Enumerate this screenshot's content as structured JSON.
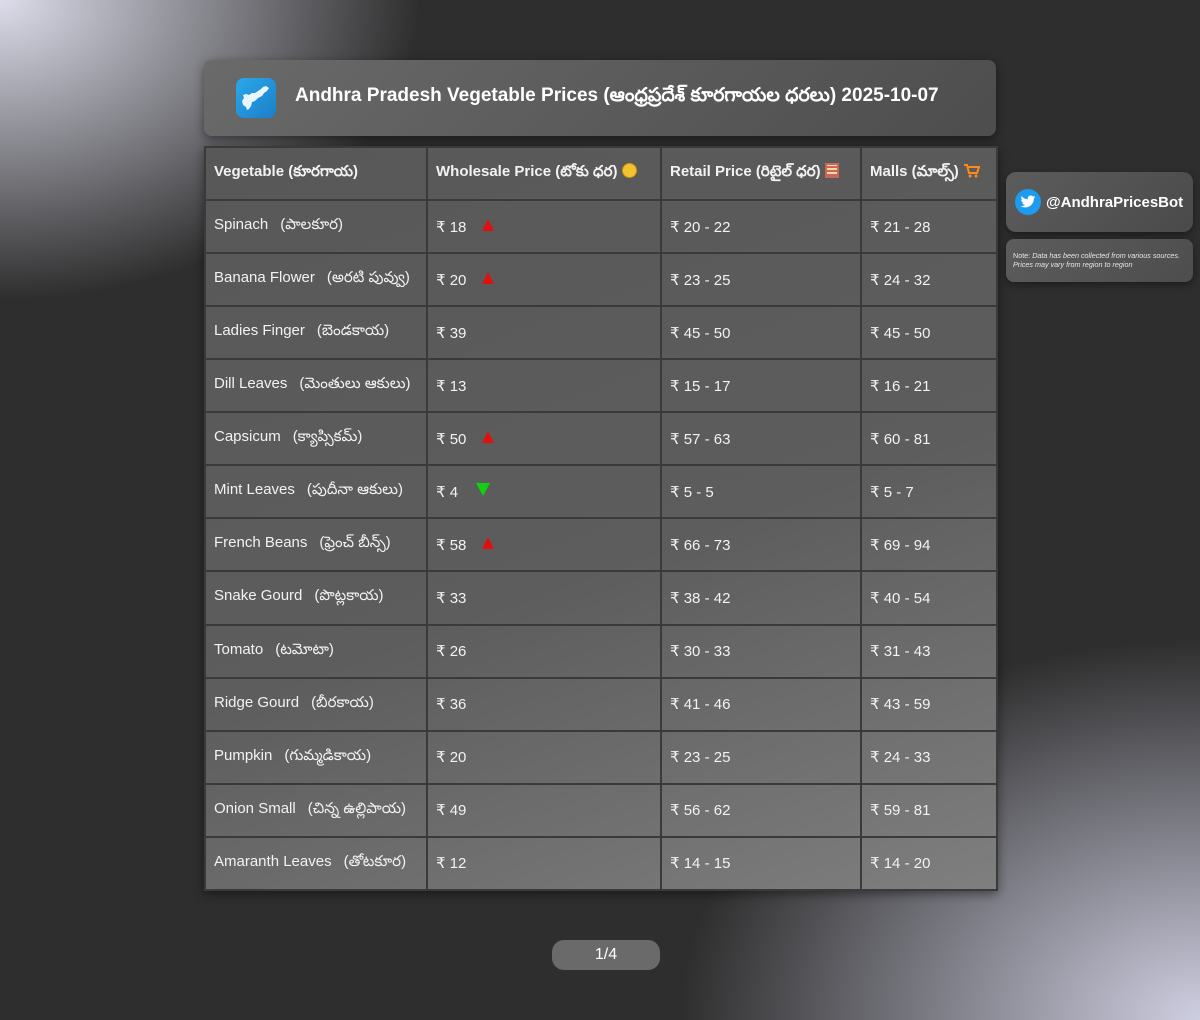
{
  "header": {
    "logo_icon": "andhra-map-icon",
    "title": "Andhra Pradesh Vegetable Prices (ఆంధ్రప్రదేశ్ కూరగాయల ధరలు) 2025-10-07"
  },
  "table": {
    "columns": [
      {
        "label": "Vegetable (కూరగాయ)",
        "icon": ""
      },
      {
        "label": "Wholesale Price (టోకు ధర)",
        "icon": "coin-icon"
      },
      {
        "label": "Retail Price (రిటైల్ ధర)",
        "icon": "building-icon"
      },
      {
        "label": "Malls (మాల్స్)",
        "icon": "cart-icon"
      }
    ],
    "rows": [
      {
        "name": "Spinach",
        "name_te": "(పాలకూర)",
        "wholesale": "₹ 18",
        "trend": "up",
        "retail": "₹ 20 - 22",
        "malls": "₹ 21 - 28"
      },
      {
        "name": "Banana Flower",
        "name_te": "(అరటి పువ్వు)",
        "wholesale": "₹ 20",
        "trend": "up",
        "retail": "₹ 23 - 25",
        "malls": "₹ 24 - 32"
      },
      {
        "name": "Ladies Finger",
        "name_te": "(బెండకాయ)",
        "wholesale": "₹ 39",
        "trend": "",
        "retail": "₹ 45 - 50",
        "malls": "₹ 45 - 50"
      },
      {
        "name": "Dill Leaves",
        "name_te": "(మెంతులు ఆకులు)",
        "wholesale": "₹ 13",
        "trend": "",
        "retail": "₹ 15 - 17",
        "malls": "₹ 16 - 21"
      },
      {
        "name": "Capsicum",
        "name_te": "(క్యాప్సికమ్)",
        "wholesale": "₹ 50",
        "trend": "up",
        "retail": "₹ 57 - 63",
        "malls": "₹ 60 - 81"
      },
      {
        "name": "Mint Leaves",
        "name_te": "(పుదీనా ఆకులు)",
        "wholesale": "₹ 4",
        "trend": "down",
        "retail": "₹ 5 - 5",
        "malls": "₹ 5 - 7"
      },
      {
        "name": "French Beans",
        "name_te": "(ఫ్రెంచ్ బీన్స్)",
        "wholesale": "₹ 58",
        "trend": "up",
        "retail": "₹ 66 - 73",
        "malls": "₹ 69 - 94"
      },
      {
        "name": "Snake Gourd",
        "name_te": "(పొట్లకాయ)",
        "wholesale": "₹ 33",
        "trend": "",
        "retail": "₹ 38 - 42",
        "malls": "₹ 40 - 54"
      },
      {
        "name": "Tomato",
        "name_te": "(టమోటా)",
        "wholesale": "₹ 26",
        "trend": "",
        "retail": "₹ 30 - 33",
        "malls": "₹ 31 - 43"
      },
      {
        "name": "Ridge Gourd",
        "name_te": "(బీరకాయ)",
        "wholesale": "₹ 36",
        "trend": "",
        "retail": "₹ 41 - 46",
        "malls": "₹ 43 - 59"
      },
      {
        "name": "Pumpkin",
        "name_te": "(గుమ్మడికాయ)",
        "wholesale": "₹ 20",
        "trend": "",
        "retail": "₹ 23 - 25",
        "malls": "₹ 24 - 33"
      },
      {
        "name": "Onion Small",
        "name_te": "(చిన్న ఉల్లిపాయ)",
        "wholesale": "₹ 49",
        "trend": "",
        "retail": "₹ 56 - 62",
        "malls": "₹ 59 - 81"
      },
      {
        "name": "Amaranth Leaves",
        "name_te": "(తోటకూర)",
        "wholesale": "₹ 12",
        "trend": "",
        "retail": "₹ 14 - 15",
        "malls": "₹ 14 - 20"
      }
    ]
  },
  "sidebar": {
    "twitter_icon": "twitter-bird-icon",
    "twitter_handle": "@AndhraPricesBot",
    "note_label": "Note:",
    "note_text": "Data has been collected from various sources. Prices may vary from region to region"
  },
  "pager": {
    "label": "1/4"
  },
  "colors": {
    "trend_up": "#e01010",
    "trend_down": "#10d010",
    "twitter": "#1d9bf0",
    "logo": "#2196db"
  }
}
